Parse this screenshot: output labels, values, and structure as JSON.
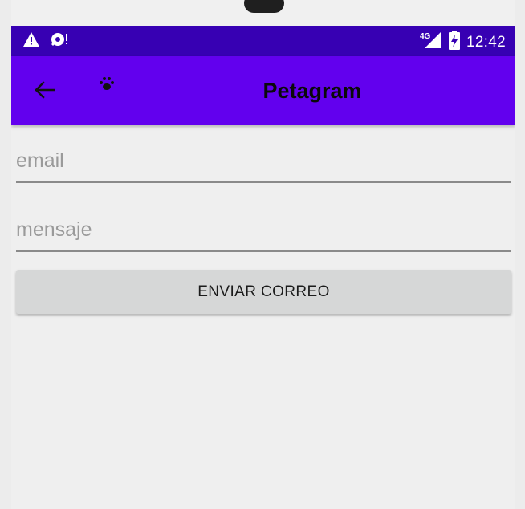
{
  "status_bar": {
    "network_label": "4G",
    "time": "12:42",
    "icons": [
      "warning-icon",
      "sync-alert-icon",
      "signal-icon",
      "battery-charging-icon"
    ]
  },
  "app_bar": {
    "title": "Petagram",
    "back_icon": "arrow-back-icon",
    "logo_icon": "paw-icon"
  },
  "form": {
    "email_placeholder": "email",
    "email_value": "",
    "message_placeholder": "mensaje",
    "message_value": "",
    "send_label": "ENVIAR CORREO"
  },
  "colors": {
    "status_bar": "#3700b3",
    "app_bar": "#6200ee",
    "background": "#efefef",
    "button": "#d6d7d7"
  }
}
